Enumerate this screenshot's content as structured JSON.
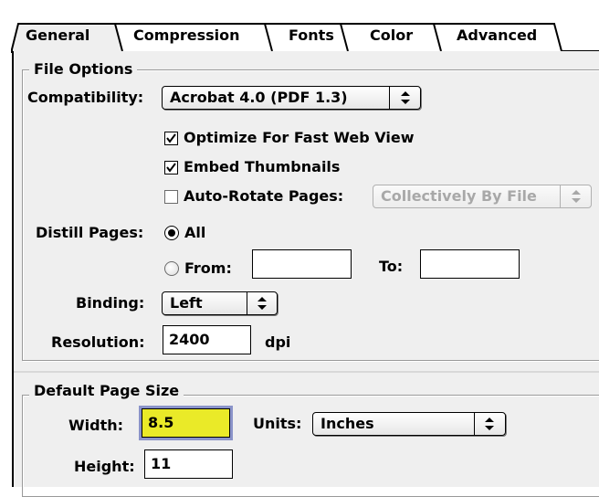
{
  "tabs": [
    "General",
    "Compression",
    "Fonts",
    "Color",
    "Advanced"
  ],
  "file_options": {
    "title": "File Options",
    "compatibility_label": "Compatibility:",
    "compatibility_value": "Acrobat 4.0 (PDF 1.3)",
    "optimize_label": "Optimize For Fast Web View",
    "optimize_checked": true,
    "thumbnails_label": "Embed Thumbnails",
    "thumbnails_checked": true,
    "autorotate_label": "Auto-Rotate Pages:",
    "autorotate_checked": false,
    "autorotate_value": "Collectively By File",
    "distill_label": "Distill Pages:",
    "all_label": "All",
    "from_label": "From:",
    "from_value": "",
    "to_label": "To:",
    "to_value": "",
    "binding_label": "Binding:",
    "binding_value": "Left",
    "resolution_label": "Resolution:",
    "resolution_value": "2400",
    "resolution_unit": "dpi"
  },
  "page_size": {
    "title": "Default Page Size",
    "width_label": "Width:",
    "width_value": "8.5",
    "units_label": "Units:",
    "units_value": "Inches",
    "height_label": "Height:",
    "height_value": "11"
  },
  "icons": {
    "popup_arrows": "up-down-arrows-icon",
    "checkmark": "checkmark-icon"
  },
  "colors": {
    "focused_field": "#eaea28",
    "focus_ring": "#8a93c9",
    "panel": "#efefef"
  }
}
